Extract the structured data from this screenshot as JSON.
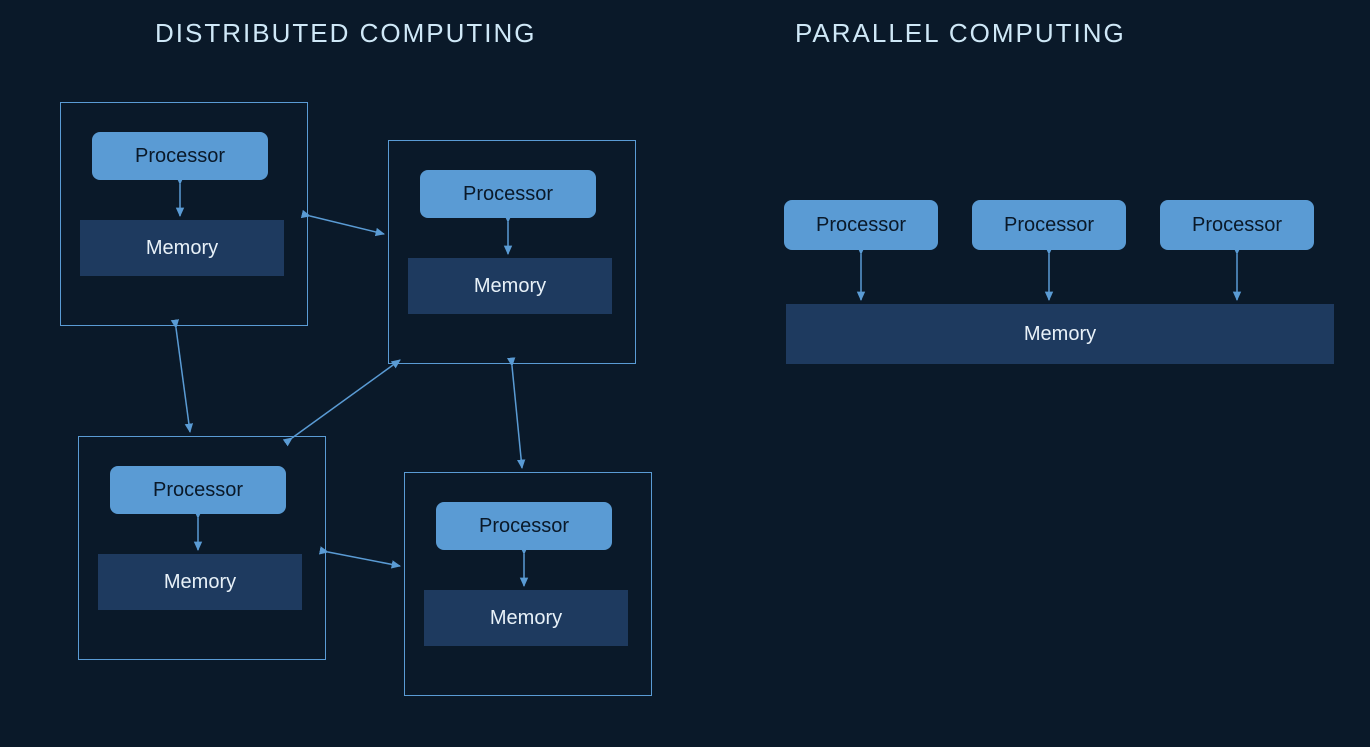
{
  "titles": {
    "distributed": "DISTRIBUTED COMPUTING",
    "parallel": "PARALLEL COMPUTING"
  },
  "labels": {
    "processor": "Processor",
    "memory": "Memory"
  },
  "colors": {
    "background": "#0a1929",
    "processorFill": "#5a9bd4",
    "memoryFill": "#1e3a5f",
    "border": "#5a9bd4",
    "text": "#cfe8f7"
  },
  "diagram": {
    "distributed": {
      "nodes": 4,
      "each_node": [
        "Processor",
        "Memory"
      ],
      "interconnect": "fully-meshed bidirectional links between nodes"
    },
    "parallel": {
      "processors": 3,
      "shared_memory": 1,
      "links": "each processor bidirectionally connected to shared memory"
    }
  }
}
